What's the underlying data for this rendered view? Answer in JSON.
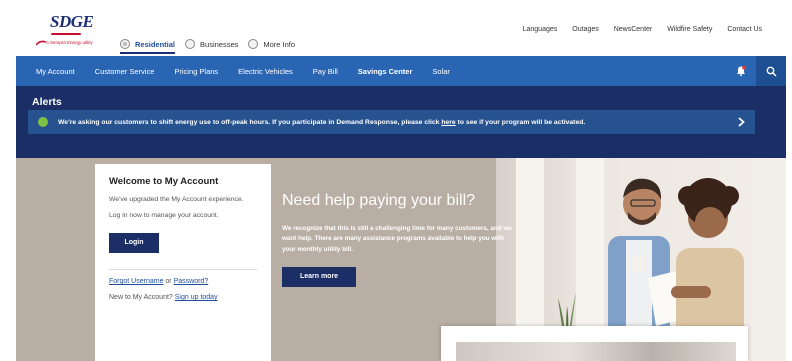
{
  "header": {
    "logo_text": "SDGE",
    "logo_tagline": "A Sempra Energy utility",
    "segments": [
      {
        "label": "Residential",
        "active": true
      },
      {
        "label": "Businesses",
        "active": false
      },
      {
        "label": "More Info",
        "active": false
      }
    ],
    "utility_links": [
      "Languages",
      "Outages",
      "NewsCenter",
      "Wildfire Safety",
      "Contact Us"
    ]
  },
  "nav": {
    "items": [
      {
        "label": "My Account",
        "bold": false
      },
      {
        "label": "Customer Service",
        "bold": false
      },
      {
        "label": "Pricing Plans",
        "bold": false
      },
      {
        "label": "Electric Vehicles",
        "bold": false
      },
      {
        "label": "Pay Bill",
        "bold": false
      },
      {
        "label": "Savings Center",
        "bold": true
      },
      {
        "label": "Solar",
        "bold": false
      }
    ],
    "icons": [
      "bell-alert-icon",
      "search-icon"
    ]
  },
  "alerts": {
    "title": "Alerts",
    "message_before": "We're asking our customers to shift energy use to off-peak hours. If you participate in Demand Response, please click ",
    "message_link": "here",
    "message_after": " to see if your program will be activated."
  },
  "account_card": {
    "title": "Welcome to My Account",
    "upgraded_text": "We've upgraded the My Account experience.",
    "login_prompt": "Log in now to manage your account.",
    "login_button": "Login",
    "forgot_username": "Forgot Username",
    "or_text": " or ",
    "password": "Password?",
    "new_prefix": "New to My Account? ",
    "sign_up": "Sign up today"
  },
  "promo": {
    "title": "Need help paying your bill?",
    "text": "We recognize that this is still a challenging time for many customers, and we want help. There are many assistance programs available to help you with your monthly utility bill.",
    "button": "Learn more"
  },
  "colors": {
    "nav_blue": "#2a65b3",
    "alerts_navy": "#1b2f66",
    "alert_bar": "#26528f",
    "alert_dot": "#7dc142",
    "brand_red": "#c8102e"
  }
}
